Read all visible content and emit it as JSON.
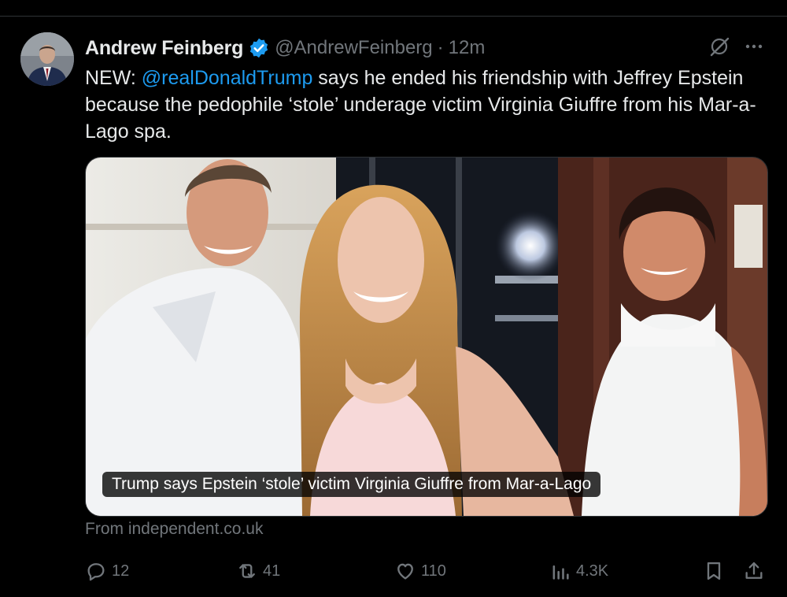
{
  "tweet": {
    "author_name": "Andrew Feinberg",
    "handle": "@AndrewFeinberg",
    "separator": "·",
    "time": "12m",
    "text_before": "NEW: ",
    "mention": "@realDonaldTrump",
    "text_after": " says he ended his friendship with Jeffrey Epstein because the pedophile ‘stole’ underage victim Virginia Giuffre from his Mar-a-Lago spa.",
    "media_caption": "Trump says Epstein ‘stole’ victim Virginia Giuffre from Mar-a-Lago",
    "source": "From independent.co.uk"
  },
  "actions": {
    "replies": "12",
    "reposts": "41",
    "likes": "110",
    "views": "4.3K"
  },
  "icons": {
    "verified": "verified-badge-icon",
    "grok": "grok-icon",
    "more": "more-icon",
    "reply": "reply-icon",
    "repost": "repost-icon",
    "like": "like-icon",
    "views": "views-icon",
    "bookmark": "bookmark-icon",
    "share": "share-icon"
  },
  "colors": {
    "background": "#000000",
    "text": "#e7e9ea",
    "muted": "#71767b",
    "accent": "#1d9bf0"
  }
}
